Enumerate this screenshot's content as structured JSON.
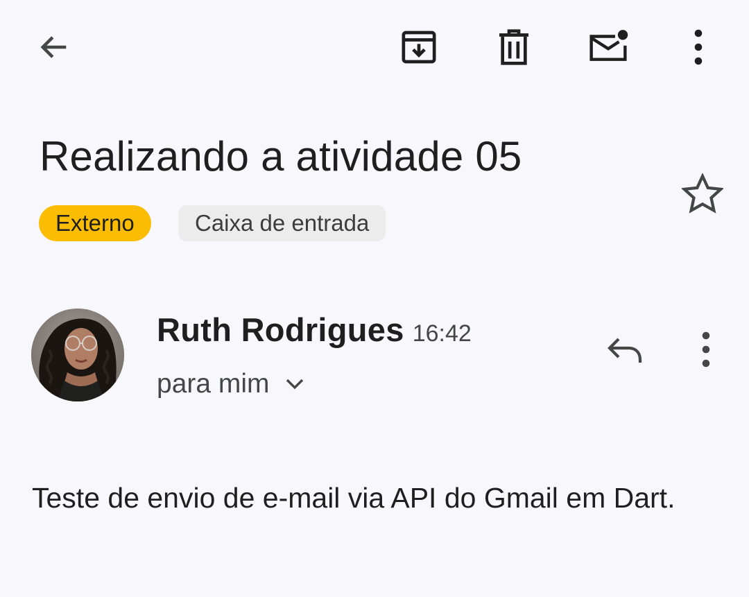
{
  "toolbar": {
    "back_icon": "arrow-left-icon",
    "archive_icon": "archive-icon",
    "delete_icon": "trash-icon",
    "mark_unread_icon": "mark-unread-icon",
    "more_icon": "more-vertical-icon"
  },
  "email": {
    "subject": "Realizando a atividade 05",
    "starred": false,
    "labels": [
      {
        "text": "Externo",
        "color": "#fbbc04"
      },
      {
        "text": "Caixa de entrada",
        "color": "#ececed"
      }
    ],
    "sender": {
      "name": "Ruth Rodrigues",
      "time": "16:42",
      "recipient_text": "para mim"
    },
    "body": "Teste de envio de e-mail via API do Gmail em Dart."
  },
  "colors": {
    "background": "#f8f8fc",
    "text_primary": "#1f1f1f",
    "text_secondary": "#444746",
    "label_external": "#fbbc04",
    "label_inbox": "#ececed"
  }
}
